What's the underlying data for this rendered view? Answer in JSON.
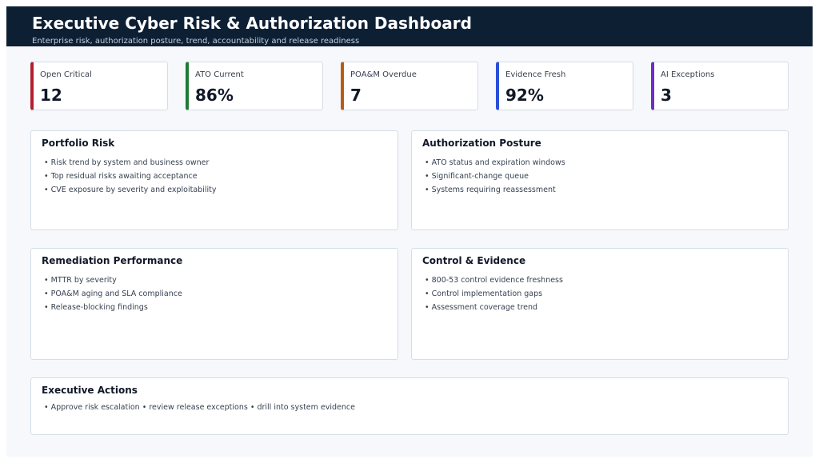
{
  "header": {
    "title": "Executive Cyber Risk & Authorization Dashboard",
    "subtitle": "Enterprise risk, authorization posture, trend, accountability and release readiness"
  },
  "kpis": [
    {
      "label": "Open Critical",
      "value": "12",
      "color": "#b3202c"
    },
    {
      "label": "ATO Current",
      "value": "86%",
      "color": "#1e7b34"
    },
    {
      "label": "POA&M Overdue",
      "value": "7",
      "color": "#b85c14"
    },
    {
      "label": "Evidence Fresh",
      "value": "92%",
      "color": "#2b4fd8"
    },
    {
      "label": "AI Exceptions",
      "value": "3",
      "color": "#6b2fc7"
    }
  ],
  "cards": {
    "portfolio_risk": {
      "title": "Portfolio Risk",
      "items": [
        "Risk trend by system and business owner",
        "Top residual risks awaiting acceptance",
        "CVE exposure by severity and exploitability"
      ]
    },
    "authorization_posture": {
      "title": "Authorization Posture",
      "items": [
        "ATO status and expiration windows",
        "Significant-change queue",
        "Systems requiring reassessment"
      ]
    },
    "remediation_performance": {
      "title": "Remediation Performance",
      "items": [
        "MTTR by severity",
        "POA&M aging and SLA compliance",
        "Release-blocking findings"
      ]
    },
    "control_evidence": {
      "title": "Control & Evidence",
      "items": [
        "800-53 control evidence freshness",
        "Control implementation gaps",
        "Assessment coverage trend"
      ]
    },
    "executive_actions": {
      "title": "Executive Actions",
      "text": "• Approve risk escalation • review release exceptions • drill into system evidence"
    }
  }
}
